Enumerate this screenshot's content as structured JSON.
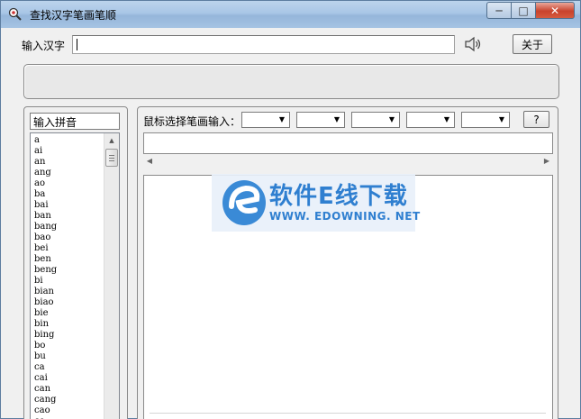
{
  "window": {
    "title": "查找汉字笔画笔顺",
    "min_label": "─",
    "max_label": "□",
    "close_label": "✕"
  },
  "toolbar": {
    "hanzi_label": "输入汉字",
    "hanzi_value": "",
    "about_label": "关于"
  },
  "pinyin": {
    "input_value": "输入拼音",
    "items": [
      "a",
      "ai",
      "an",
      "ang",
      "ao",
      "ba",
      "bai",
      "ban",
      "bang",
      "bao",
      "bei",
      "ben",
      "beng",
      "bi",
      "bian",
      "biao",
      "bie",
      "bin",
      "bing",
      "bo",
      "bu",
      "ca",
      "cai",
      "can",
      "cang",
      "cao",
      "ce"
    ]
  },
  "stroke": {
    "mouse_label": "鼠标选择笔画输入：",
    "selects": [
      "",
      "",
      "",
      "",
      ""
    ],
    "help_label": "?",
    "field_value": ""
  },
  "watermark": {
    "main": "软件E线下载",
    "sub": "WWW. EDOWNING. NET"
  },
  "colors": {
    "title_bar": "#a9c6e6",
    "watermark_blue": "#2f7fd0",
    "close_red": "#c8422c"
  },
  "icons": {
    "app": "search-person-icon",
    "speaker": "speaker-icon",
    "dropdown": "dropdown-arrow-icon"
  }
}
